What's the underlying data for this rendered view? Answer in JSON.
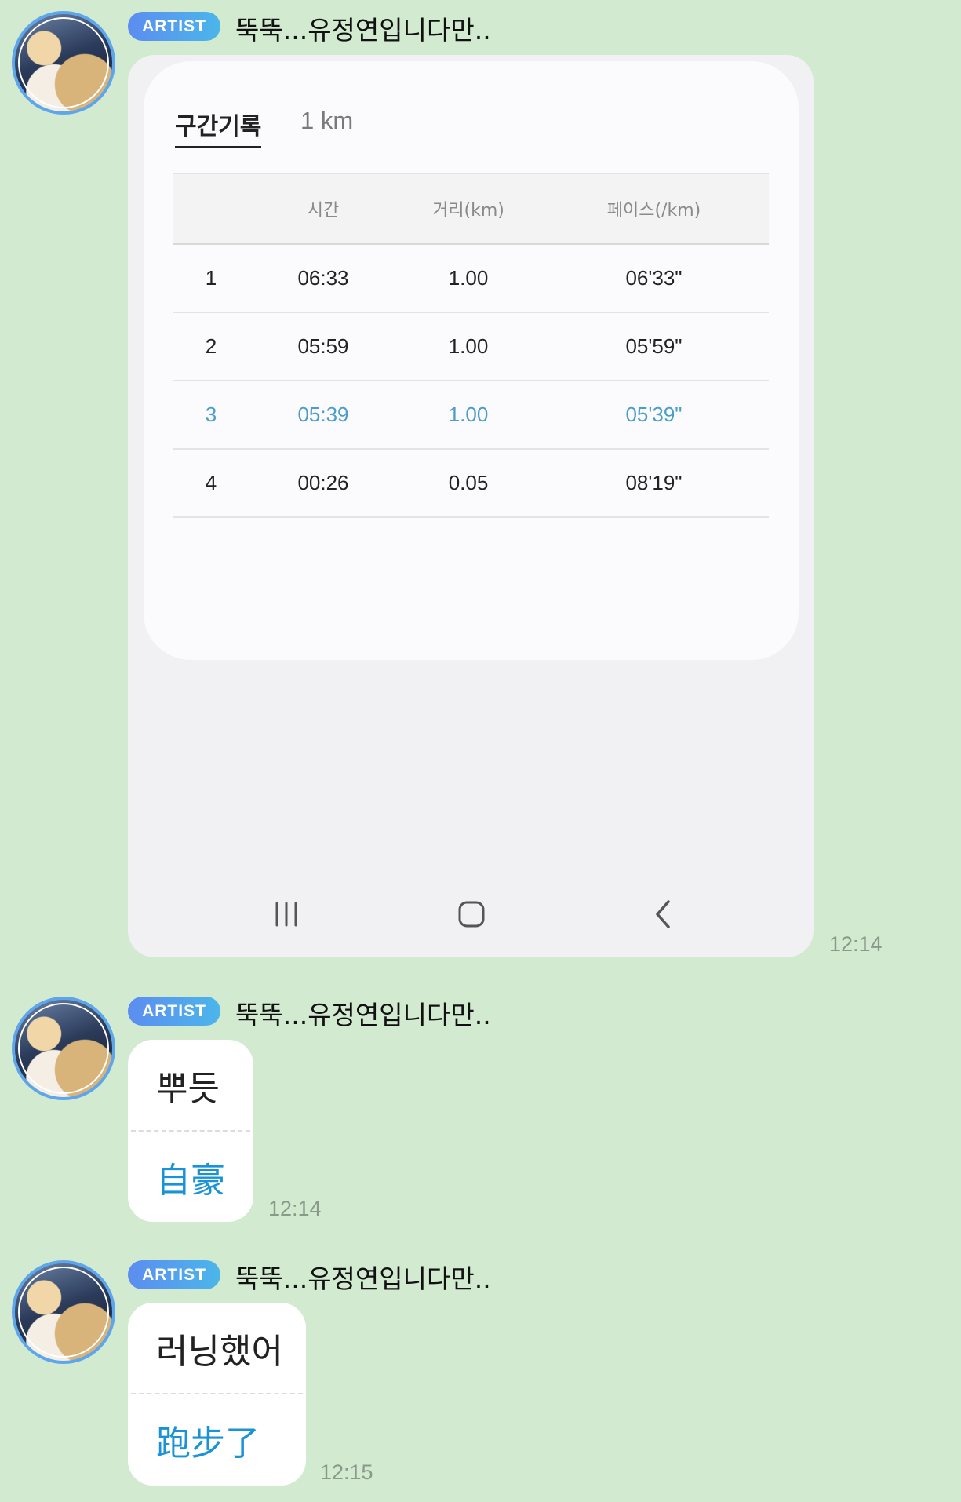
{
  "messages": [
    {
      "badge": "ARTIST",
      "sender": "뚝뚝...유정연입니다만..",
      "time": "12:14",
      "image": {
        "tabs": [
          "구간기록",
          "1 km"
        ],
        "headers": [
          "",
          "시간",
          "거리(km)",
          "페이스(/km)"
        ],
        "rows": [
          [
            "1",
            "06:33",
            "1.00",
            "06'33\""
          ],
          [
            "2",
            "05:59",
            "1.00",
            "05'59\""
          ],
          [
            "3",
            "05:39",
            "1.00",
            "05'39\""
          ],
          [
            "4",
            "00:26",
            "0.05",
            "08'19\""
          ]
        ],
        "highlight_color": "#4a9ec9",
        "nav_icons": [
          "recent-apps-icon",
          "home-icon",
          "back-icon"
        ]
      }
    },
    {
      "badge": "ARTIST",
      "sender": "뚝뚝...유정연입니다만..",
      "text": "뿌듯",
      "translation": "自豪",
      "time": "12:14"
    },
    {
      "badge": "ARTIST",
      "sender": "뚝뚝...유정연입니다만..",
      "text": "러닝했어",
      "translation": "跑步了",
      "time": "12:15"
    }
  ],
  "colors": {
    "background": "#d2ead0",
    "translation_text": "#1a93d6",
    "avatar_ring": "#5ea6ec"
  }
}
